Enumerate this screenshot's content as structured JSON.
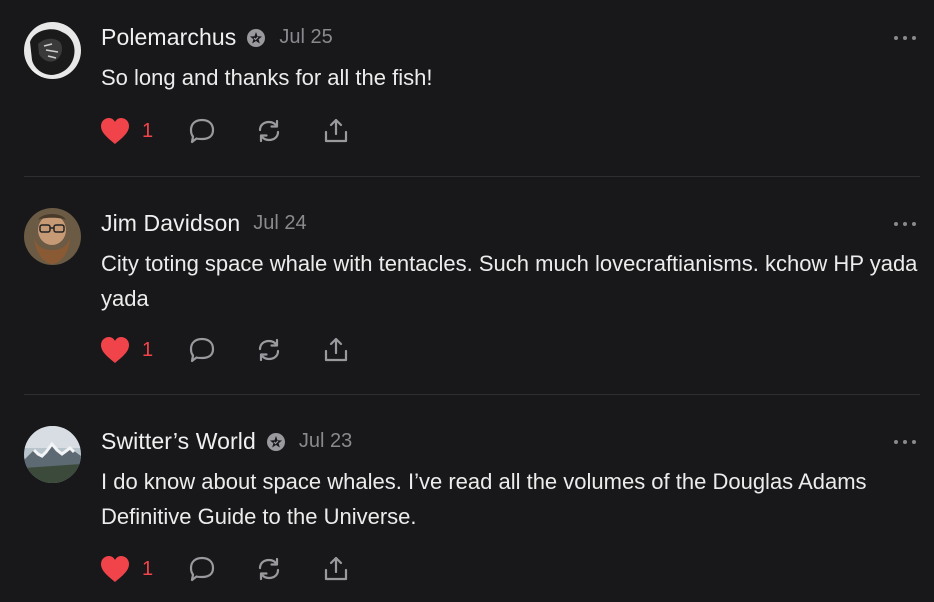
{
  "posts": [
    {
      "author": "Polemarchus",
      "verified": true,
      "date": "Jul 25",
      "text": "So long and thanks for all the fish!",
      "likes": "1",
      "avatar_icon": "dark-sketch-avatar"
    },
    {
      "author": "Jim Davidson",
      "verified": false,
      "date": "Jul 24",
      "text": "City toting space whale with tentacles. Such much lovecraftianisms. kchow HP yada yada",
      "likes": "1",
      "avatar_icon": "bearded-man-avatar"
    },
    {
      "author": "Switter’s World",
      "verified": true,
      "date": "Jul 23",
      "text": "I do know about space whales. I’ve read all the volumes of the Douglas Adams Definitive Guide to the Universe.",
      "likes": "1",
      "avatar_icon": "mountain-landscape-avatar"
    }
  ],
  "colors": {
    "background": "#18181a",
    "like": "#f0444a",
    "muted": "#8a8a8e"
  }
}
